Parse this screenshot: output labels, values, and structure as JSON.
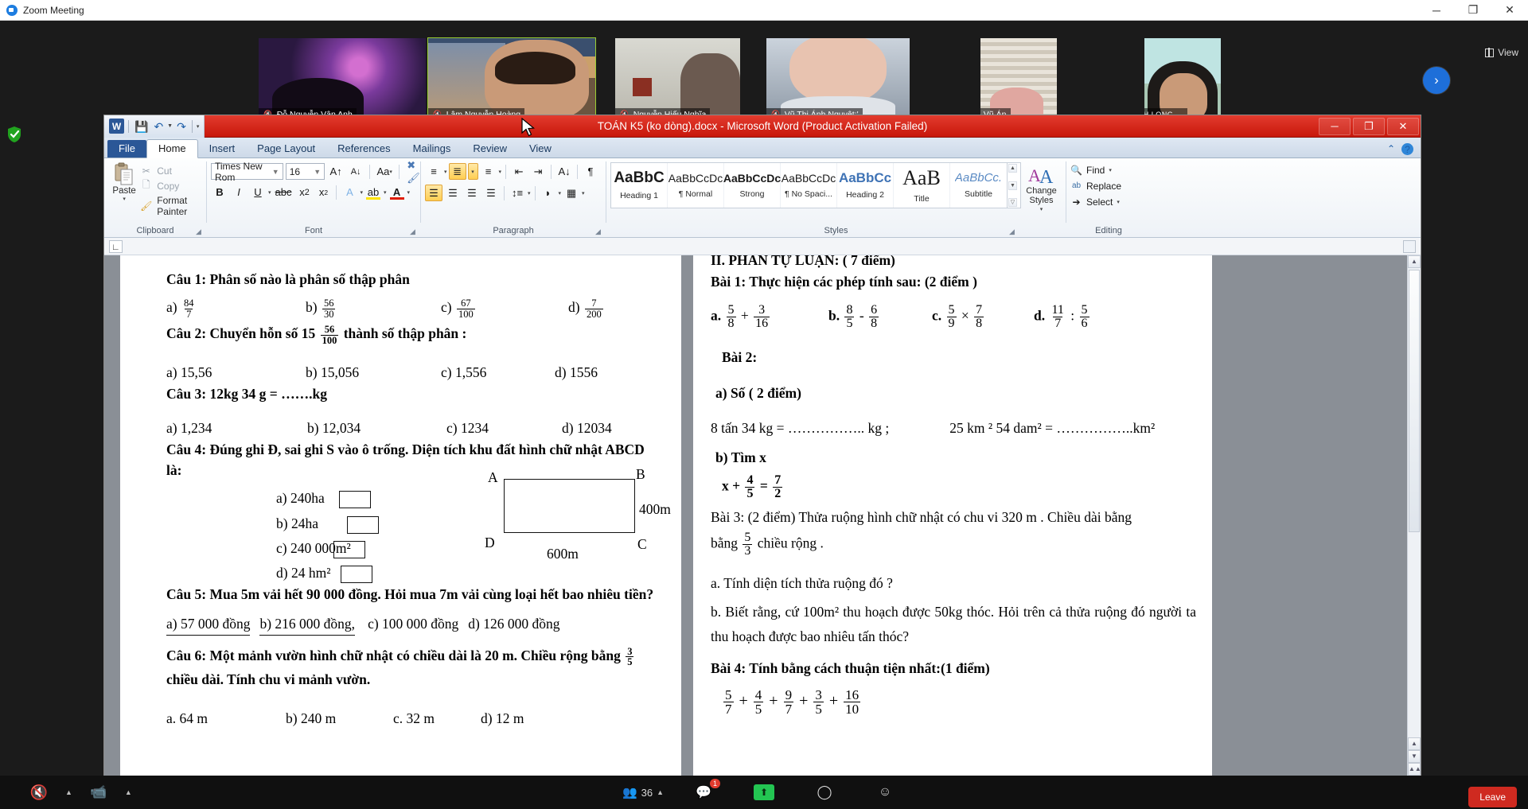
{
  "zoom_app": {
    "window_title": "Zoom Meeting",
    "window_buttons": {
      "minimize": "─",
      "restore": "❐",
      "close": "✕"
    },
    "view_button": "View",
    "next_arrow": "›",
    "participants": [
      {
        "name": "Đỗ Nguyễn Vân Anh",
        "muted": true,
        "active": false
      },
      {
        "name": "Lâm Nguyễn Hoàng",
        "muted": true,
        "active": true
      },
      {
        "name": "Nguyễn Hiếu Nghĩa",
        "muted": true,
        "active": false
      },
      {
        "name": "Vũ Thị Ánh Nguyệt:'",
        "muted": true,
        "active": false
      },
      {
        "name": "Nguyễn Vũ Ánh Nguyệt",
        "muted": true,
        "active": false
      },
      {
        "name": "MINH LONG",
        "muted": true,
        "active": false
      }
    ],
    "toolbar": {
      "mute_label": "",
      "video_label": "",
      "participants_count": "36",
      "chat_badge": "1",
      "share_label": "",
      "record_label": "",
      "reactions_label": "",
      "leave_label": "Leave"
    }
  },
  "word": {
    "title": "TOÁN K5 (ko dòng).docx  -  Microsoft Word (Product Activation Failed)",
    "quick_access": [
      "save-icon",
      "undo-icon",
      "redo-icon",
      "customize-icon"
    ],
    "window_buttons": {
      "minimize": "─",
      "restore": "❐",
      "close": "✕"
    },
    "tabs": [
      "File",
      "Home",
      "Insert",
      "Page Layout",
      "References",
      "Mailings",
      "Review",
      "View"
    ],
    "active_tab": "Home",
    "help": {
      "collapse": "⌃",
      "question": "?"
    },
    "groups": {
      "clipboard": {
        "label": "Clipboard",
        "paste": "Paste",
        "items": [
          "Cut",
          "Copy",
          "Format Painter"
        ]
      },
      "font": {
        "label": "Font",
        "font_name": "Times New Rom",
        "font_size": "16",
        "buttons": [
          "grow-font",
          "shrink-font",
          "change-case",
          "clear-formatting",
          "bold",
          "italic",
          "underline",
          "strikethrough",
          "subscript",
          "superscript",
          "text-effects",
          "highlight",
          "font-color"
        ]
      },
      "paragraph": {
        "label": "Paragraph",
        "buttons": [
          "bullets",
          "numbering",
          "multilevel-list",
          "decrease-indent",
          "increase-indent",
          "sort",
          "show-marks",
          "align-left",
          "align-center",
          "align-right",
          "justify",
          "line-spacing",
          "shading",
          "borders"
        ]
      },
      "styles": {
        "label": "Styles",
        "items": [
          {
            "preview": "AaBbC",
            "name": "Heading 1"
          },
          {
            "preview": "AaBbCcDc",
            "name": "¶ Normal"
          },
          {
            "preview": "AaBbCcDc",
            "name": "Strong"
          },
          {
            "preview": "AaBbCcDc",
            "name": "¶ No Spaci..."
          },
          {
            "preview": "AaBbCc",
            "name": "Heading 2"
          },
          {
            "preview": "AaB",
            "name": "Title"
          },
          {
            "preview": "AaBbCc.",
            "name": "Subtitle"
          }
        ],
        "change_styles": "Change Styles"
      },
      "editing": {
        "label": "Editing",
        "items": [
          "Find",
          "Replace",
          "Select"
        ]
      }
    },
    "document": {
      "left_page": {
        "q1": {
          "prompt": "Câu 1: Phân số nào là phân số thập phân",
          "options": [
            {
              "label": "a)",
              "num": "84",
              "den": "7"
            },
            {
              "label": "b)",
              "num": "56",
              "den": "30"
            },
            {
              "label": "c)",
              "num": "67",
              "den": "100"
            },
            {
              "label": "d)",
              "num": "7",
              "den": "200"
            }
          ]
        },
        "q2": {
          "prompt_a": "Câu 2: Chuyển hỗn số 15",
          "num": "56",
          "den": "100",
          "prompt_b": "thành số thập phân :",
          "options": [
            "a)  15,56",
            "b)  15,056",
            "c) 1,556",
            "d)  1556"
          ]
        },
        "q3": {
          "prompt": "Câu 3:    12kg 34 g = …….kg",
          "options": [
            "a) 1,234",
            "b) 12,034",
            "c) 1234",
            "d) 12034"
          ]
        },
        "q4": {
          "prompt": "Câu 4: Đúng ghi Đ, sai ghi S vào ô trống. Diện tích khu đất hình chữ nhật ABCD là:",
          "options": [
            "a)  240ha",
            "b)  24ha",
            "c)  240 000m²",
            "d)  24 hm²"
          ],
          "figure": {
            "A": "A",
            "B": "B",
            "C": "C",
            "D": "D",
            "height": "400m",
            "width": "600m"
          }
        },
        "q5": {
          "prompt": "Câu 5: Mua 5m vải  hết 90 000 đồng. Hỏi mua 7m vải cùng loại hết bao nhiêu tiền?",
          "options": [
            "a) 57 000 đồng",
            "b) 216 000 đồng,",
            "c) 100 000 đồng",
            "d) 126 000 đồng"
          ]
        },
        "q6": {
          "prompt_a": "Câu 6:  Một mảnh vườn hình chữ nhật có chiều dài là 20 m. Chiều rộng bằng",
          "num": "3",
          "den": "5",
          "prompt_b": "chiều dài. Tính chu vi mảnh vườn.",
          "options": [
            "a. 64 m",
            "b) 240 m",
            "c. 32 m",
            "d) 12 m"
          ]
        }
      },
      "right_page": {
        "section_heading": "II. PHẦN TỰ LUẬN: ( 7 điểm)",
        "bai1": {
          "prompt": "Bài 1: Thực hiện các phép tính sau:  (2 điểm )",
          "items": [
            {
              "label": "a.",
              "n1": "5",
              "d1": "8",
              "op": "+",
              "n2": "3",
              "d2": "16"
            },
            {
              "label": "b.",
              "n1": "8",
              "d1": "5",
              "op": "-",
              "n2": "6",
              "d2": "8"
            },
            {
              "label": "c.",
              "n1": "5",
              "d1": "9",
              "op": "×",
              "n2": "7",
              "d2": "8"
            },
            {
              "label": "d.",
              "n1": "11",
              "d1": "7",
              "op": ":",
              "n2": "5",
              "d2": "6"
            }
          ]
        },
        "bai2": {
          "prompt": "Bài 2:",
          "part_a": "a) Số ( 2 điểm)",
          "fill1": "8 tấn 34 kg = ……………..  kg  ;",
          "fill2": "25 km ² 54 dam² = ……………..km²",
          "part_b": "b) Tìm x",
          "equation": {
            "lhs": "x +",
            "n1": "4",
            "d1": "5",
            "eq": "=",
            "n2": "7",
            "d2": "2"
          }
        },
        "bai3": {
          "prompt_a": "Bài 3: (2 điểm) Thửa ruộng hình chữ nhật có chu vi 320 m . Chiều dài bằng",
          "num": "5",
          "den": "3",
          "prompt_b": "chiều rộng .",
          "a": "a. Tính diện tích thửa ruộng đó ?",
          "b": "b. Biết rằng, cứ 100m² thu hoạch được 50kg thóc. Hỏi trên cả thửa ruộng đó người ta thu hoạch được bao nhiêu tấn thóc?"
        },
        "bai4": {
          "prompt": "Bài 4: Tính bằng cách thuận tiện nhất:(1 điểm)",
          "terms": [
            {
              "num": "5",
              "den": "7"
            },
            {
              "num": "4",
              "den": "5"
            },
            {
              "num": "9",
              "den": "7"
            },
            {
              "num": "3",
              "den": "5"
            },
            {
              "num": "16",
              "den": "10"
            }
          ],
          "op": "+"
        }
      }
    }
  },
  "colors": {
    "word_title_red": "#cc1a0d",
    "accent_blue": "#1e6fd9",
    "leave_red": "#cf2a20",
    "share_green": "#23c552"
  }
}
